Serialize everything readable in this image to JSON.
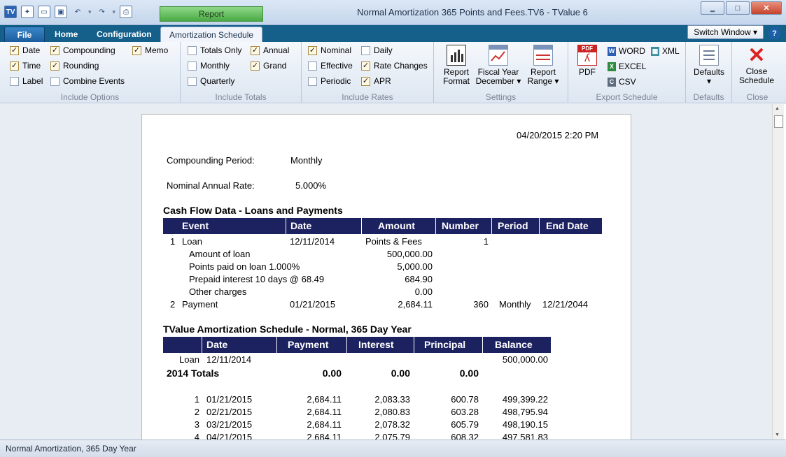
{
  "window": {
    "title": "Normal Amortization 365 Points and Fees.TV6 - TValue 6",
    "context_tab": "Report",
    "app_icon": "TV",
    "min_icon": "minimize-icon",
    "max_icon": "maximize-icon",
    "close_icon": "close-icon"
  },
  "tabs": {
    "file": "File",
    "home": "Home",
    "configuration": "Configuration",
    "amortization": "Amortization Schedule",
    "switch_window": "Switch Window ▾",
    "help": "?"
  },
  "ribbon": {
    "include_options": {
      "label": "Include Options",
      "date": "Date",
      "time": "Time",
      "label_cb": "Label",
      "compounding": "Compounding",
      "rounding": "Rounding",
      "combine_events": "Combine Events",
      "memo": "Memo"
    },
    "include_totals": {
      "label": "Include Totals",
      "totals_only": "Totals Only",
      "monthly": "Monthly",
      "quarterly": "Quarterly",
      "annual": "Annual",
      "grand": "Grand"
    },
    "include_rates": {
      "label": "Include Rates",
      "nominal": "Nominal",
      "effective": "Effective",
      "periodic": "Periodic",
      "daily": "Daily",
      "rate_changes": "Rate Changes",
      "apr": "APR"
    },
    "settings": {
      "label": "Settings",
      "report_format_1": "Report",
      "report_format_2": "Format",
      "fiscal_year_1": "Fiscal Year",
      "fiscal_year_2": "December ▾",
      "report_range_1": "Report",
      "report_range_2": "Range ▾"
    },
    "export": {
      "label": "Export Schedule",
      "pdf": "PDF",
      "word": "WORD",
      "excel": "EXCEL",
      "csv": "CSV",
      "xml": "XML"
    },
    "defaults": {
      "label": "Defaults",
      "button": "Defaults",
      "arrow": "▾"
    },
    "close": {
      "label": "Close",
      "button_1": "Close",
      "button_2": "Schedule"
    }
  },
  "report": {
    "timestamp": "04/20/2015   2:20 PM",
    "compounding_label": "Compounding Period:",
    "compounding_value": "Monthly",
    "nominal_label": "Nominal Annual Rate:",
    "nominal_value": "5.000%",
    "cashflow_title": "Cash Flow Data - Loans and Payments",
    "cashflow_headers": [
      "Event",
      "Date",
      "Amount",
      "Number",
      "Period",
      "End Date"
    ],
    "cashflow_rows": [
      {
        "num": "1",
        "event": "Loan",
        "date": "12/11/2014",
        "amount": "Points & Fees",
        "number": "1",
        "period": "",
        "end": ""
      },
      {
        "num": "2",
        "event": "Payment",
        "date": "01/21/2015",
        "amount": "2,684.11",
        "number": "360",
        "period": "Monthly",
        "end": "12/21/2044"
      }
    ],
    "loan_details": [
      {
        "label": "Amount of loan",
        "value": "500,000.00"
      },
      {
        "label": "Points paid on loan 1.000%",
        "value": "5,000.00"
      },
      {
        "label": "Prepaid interest 10 days @ 68.49",
        "value": "684.90"
      },
      {
        "label": "Other charges",
        "value": "0.00"
      }
    ],
    "amort_title": "TValue Amortization Schedule - Normal, 365 Day Year",
    "amort_headers": [
      "Date",
      "Payment",
      "Interest",
      "Principal",
      "Balance"
    ],
    "loan_row": {
      "label": "Loan",
      "date": "12/11/2014",
      "balance": "500,000.00"
    },
    "totals_row": {
      "label": "2014 Totals",
      "payment": "0.00",
      "interest": "0.00",
      "principal": "0.00"
    },
    "amort_rows": [
      {
        "n": "1",
        "date": "01/21/2015",
        "payment": "2,684.11",
        "interest": "2,083.33",
        "principal": "600.78",
        "balance": "499,399.22"
      },
      {
        "n": "2",
        "date": "02/21/2015",
        "payment": "2,684.11",
        "interest": "2,080.83",
        "principal": "603.28",
        "balance": "498,795.94"
      },
      {
        "n": "3",
        "date": "03/21/2015",
        "payment": "2,684.11",
        "interest": "2,078.32",
        "principal": "605.79",
        "balance": "498,190.15"
      },
      {
        "n": "4",
        "date": "04/21/2015",
        "payment": "2,684.11",
        "interest": "2,075.79",
        "principal": "608.32",
        "balance": "497,581.83"
      }
    ]
  },
  "status": {
    "text": "Normal Amortization, 365 Day Year"
  }
}
